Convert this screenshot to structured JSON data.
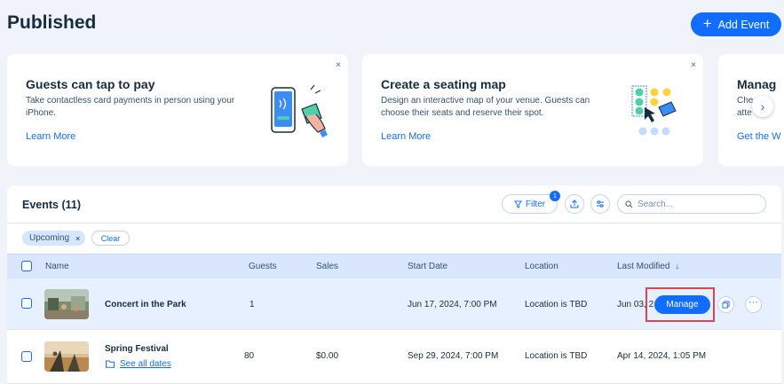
{
  "page": {
    "title": "Published",
    "add_button": "Add Event"
  },
  "promos": [
    {
      "title": "Guests can tap to pay",
      "description": "Take contactless card payments in person using your iPhone.",
      "link": "Learn More",
      "close": "×"
    },
    {
      "title": "Create a seating map",
      "description": "Design an interactive map of your venue. Guests can choose their seats and reserve their spot.",
      "link": "Learn More",
      "close": "×"
    },
    {
      "title": "Manag",
      "description_line1": "Che     ge",
      "description_line2": "atte",
      "link": "Get the W"
    }
  ],
  "events": {
    "title": "Events (11)",
    "filter_label": "Filter",
    "filter_count": "1",
    "search_placeholder": "Search...",
    "chip_label": "Upcoming",
    "chip_remove": "×",
    "clear_label": "Clear",
    "columns": {
      "name": "Name",
      "guests": "Guests",
      "sales": "Sales",
      "start_date": "Start Date",
      "location": "Location",
      "last_modified": "Last Modified",
      "sort_arrow": "↓"
    },
    "rows": [
      {
        "name": "Concert in the Park",
        "guests": "1",
        "sales": "",
        "start_date": "Jun 17, 2024, 7:00 PM",
        "location": "Location is TBD",
        "last_modified": "Jun 03, 2",
        "action": "Manage"
      },
      {
        "name": "Spring Festival",
        "sub_link": "See all dates",
        "guests": "80",
        "sales": "$0.00",
        "start_date": "Sep 29, 2024, 7:00 PM",
        "location": "Location is TBD",
        "last_modified": "Apr 14, 2024, 1:05 PM"
      }
    ]
  },
  "colors": {
    "accent": "#116dff",
    "highlight": "#e0454a",
    "background": "#f0f3f9"
  }
}
